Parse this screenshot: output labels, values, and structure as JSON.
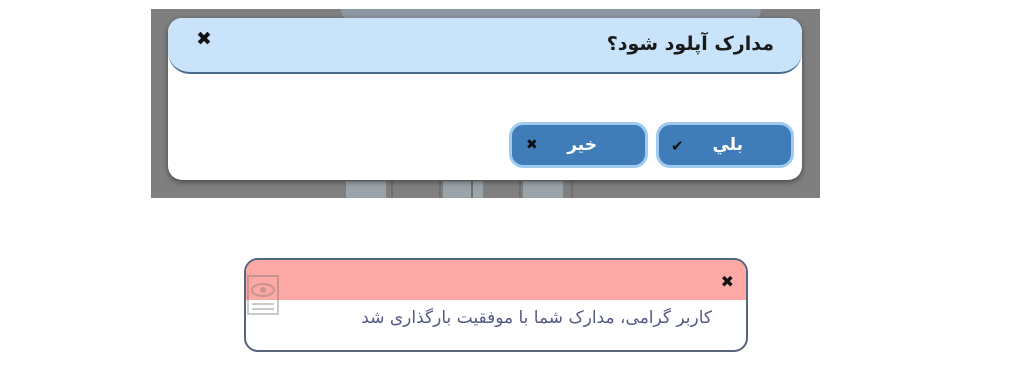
{
  "confirm_dialog": {
    "title": "مدارک آپلود شود؟",
    "close_icon": "close-icon",
    "yes_button": {
      "label": "بلي",
      "icon": "checkmark-icon"
    },
    "no_button": {
      "label": "خير",
      "icon": "close-icon"
    },
    "colors": {
      "header": "#c9e4fa",
      "button": "#3f7cb8",
      "button_border": "#9fcbef"
    }
  },
  "notification": {
    "message": "کاربر گرامی، مدارک شما با موفقیت بارگذاری شد",
    "close_icon": "close-icon",
    "watermark_icon": "document-eye-icon",
    "colors": {
      "header": "#fca9a5",
      "text": "#555a86"
    }
  }
}
